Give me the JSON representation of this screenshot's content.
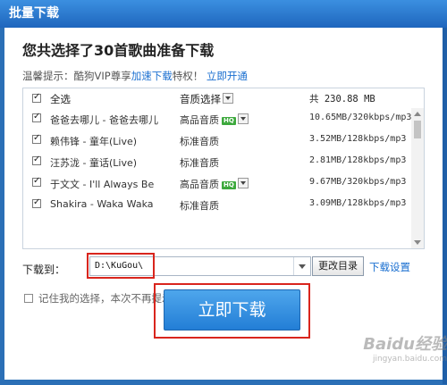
{
  "window": {
    "title": "批量下载"
  },
  "heading": "您共选择了30首歌曲准备下载",
  "tip": {
    "prefix": "温馨提示：酷狗VIP尊享",
    "link1": "加速下载",
    "middle": "特权！",
    "link2": "立即开通"
  },
  "list": {
    "header": {
      "select_all": "全选",
      "quality": "音质选择",
      "total": "共 230.88 MB"
    },
    "rows": [
      {
        "name": "爸爸去哪儿 - 爸爸去哪儿",
        "quality": "高品音质",
        "hq": "HQ",
        "has_dropdown": true,
        "size": "10.65MB/320kbps/mp3"
      },
      {
        "name": "赖伟锋 - 童年(Live)",
        "quality": "标准音质",
        "hq": "",
        "has_dropdown": false,
        "size": "3.52MB/128kbps/mp3"
      },
      {
        "name": "汪苏泷 - 童话(Live)",
        "quality": "标准音质",
        "hq": "",
        "has_dropdown": false,
        "size": "2.81MB/128kbps/mp3"
      },
      {
        "name": "于文文 - I'll Always Be",
        "quality": "高品音质",
        "hq": "HQ",
        "has_dropdown": true,
        "size": "9.67MB/320kbps/mp3"
      },
      {
        "name": "Shakira - Waka Waka",
        "quality": "标准音质",
        "hq": "",
        "has_dropdown": false,
        "size": "3.09MB/128kbps/mp3"
      }
    ]
  },
  "download_to": {
    "label": "下载到：",
    "path": "D:\\KuGou\\",
    "change_button": "更改目录",
    "settings_link": "下载设置"
  },
  "remember": {
    "label": "记住我的选择，本次不再提示"
  },
  "download_button": "立即下载",
  "watermark": {
    "logo": "Baidu经验",
    "url": "jingyan.baidu.com"
  },
  "colors": {
    "accent": "#1a6fd0",
    "highlight": "#d9251d",
    "hq_badge": "#3da93d"
  }
}
